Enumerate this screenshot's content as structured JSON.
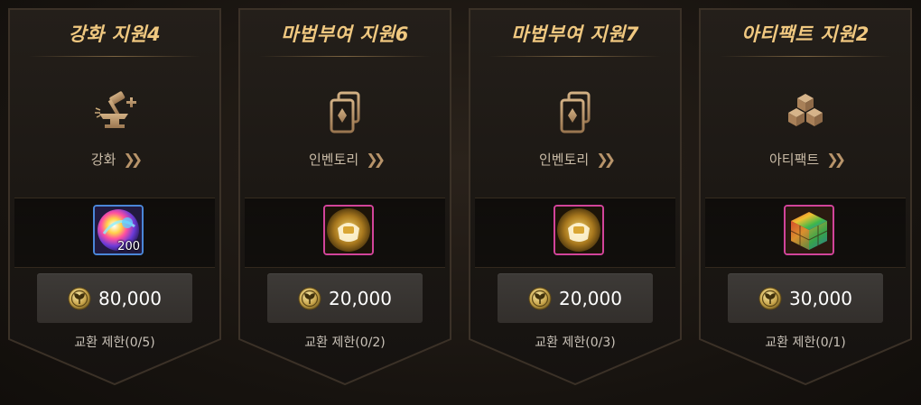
{
  "colors": {
    "title_gold": "#f0c880",
    "icon_bronze": "#b8946a",
    "price_bg": "#3a3633",
    "rarity_blue": "#4a86d8",
    "rarity_pink": "#d2449a"
  },
  "cards": [
    {
      "title": "강화 지원4",
      "category_icon": "hammer-anvil-icon",
      "category_label": "강화",
      "item_icon": "rainbow-orb-icon",
      "item_count": "200",
      "price": "80,000",
      "limit": "교환 제한(0/5)"
    },
    {
      "title": "마법부여 지원6",
      "category_icon": "cards-icon",
      "category_label": "인벤토리",
      "item_icon": "golden-pouch-icon",
      "item_count": "",
      "price": "20,000",
      "limit": "교환 제한(0/2)"
    },
    {
      "title": "마법부여 지원7",
      "category_icon": "cards-icon",
      "category_label": "인벤토리",
      "item_icon": "golden-pouch-icon",
      "item_count": "",
      "price": "20,000",
      "limit": "교환 제한(0/3)"
    },
    {
      "title": "아티팩트 지원2",
      "category_icon": "artifact-cubes-icon",
      "category_label": "아티팩트",
      "item_icon": "rainbow-cube-icon",
      "item_count": "",
      "price": "30,000",
      "limit": "교환 제한(0/1)"
    }
  ]
}
